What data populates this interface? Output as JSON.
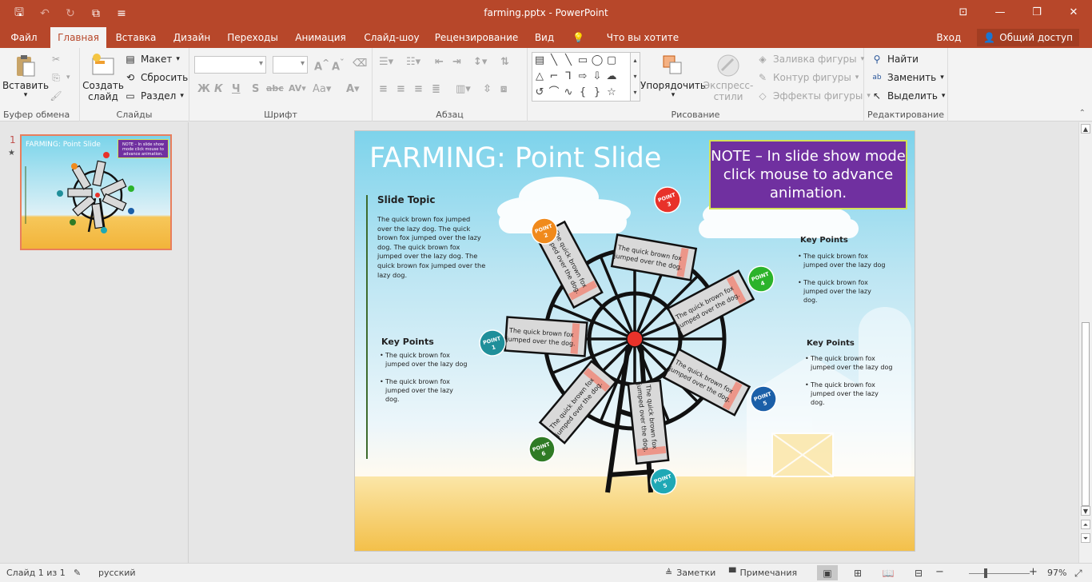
{
  "window": {
    "title": "farming.pptx - PowerPoint"
  },
  "tabs": [
    {
      "label": "Файл",
      "active": false
    },
    {
      "label": "Главная",
      "active": true
    },
    {
      "label": "Вставка",
      "active": false
    },
    {
      "label": "Дизайн",
      "active": false
    },
    {
      "label": "Переходы",
      "active": false
    },
    {
      "label": "Анимация",
      "active": false
    },
    {
      "label": "Слайд-шоу",
      "active": false
    },
    {
      "label": "Рецензирование",
      "active": false
    },
    {
      "label": "Вид",
      "active": false
    }
  ],
  "tellme": "Что вы хотите сделать?",
  "signin": "Вход",
  "share": "Общий доступ",
  "ribbon": {
    "clipboard": {
      "paste": "Вставить",
      "label": "Буфер обмена"
    },
    "slides": {
      "new_slide_1": "Создать",
      "new_slide_2": "слайд",
      "layout": "Макет",
      "reset": "Сбросить",
      "section": "Раздел",
      "label": "Слайды"
    },
    "font": {
      "label": "Шрифт",
      "bold": "Ж",
      "italic": "К",
      "underline": "Ч",
      "strike": "S",
      "aa": "Аа"
    },
    "paragraph": {
      "label": "Абзац"
    },
    "drawing": {
      "arrange": "Упорядочить",
      "styles_1": "Экспресс-",
      "styles_2": "стили",
      "fill": "Заливка фигуры",
      "outline": "Контур фигуры",
      "effects": "Эффекты фигуры",
      "label": "Рисование"
    },
    "editing": {
      "find": "Найти",
      "replace": "Заменить",
      "select": "Выделить",
      "label": "Редактирование"
    }
  },
  "thumb": {
    "number": "1",
    "star": "★",
    "title": "FARMING: Point Slide",
    "note": "NOTE – In slide show mode click mouse to advance animation."
  },
  "slide": {
    "title": "FARMING: Point Slide",
    "note": "NOTE – In slide show mode click mouse to advance animation.",
    "topic_heading": "Slide Topic",
    "topic_body": "The quick brown fox jumped over the lazy dog. The quick brown fox jumped over the lazy dog. The quick brown fox jumped over the lazy dog. The quick brown fox jumped over the lazy dog.",
    "left_kp": {
      "heading": "Key Points",
      "items": [
        "The quick brown fox jumped over the lazy dog",
        "The quick brown fox jumped over the lazy dog."
      ]
    },
    "right_kp1": {
      "heading": "Key Points",
      "items": [
        "The quick brown fox jumped over the lazy dog",
        "The quick brown fox jumped over the lazy dog."
      ]
    },
    "right_kp2": {
      "heading": "Key Points",
      "items": [
        "The quick brown fox jumped over the lazy dog",
        "The quick brown fox jumped over the lazy dog."
      ]
    },
    "blade_text": "The quick brown fox jumped over the dog.",
    "points": [
      {
        "word": "POINT",
        "num": "1",
        "color": "#1f8f9a"
      },
      {
        "word": "POINT",
        "num": "2",
        "color": "#f08a1c"
      },
      {
        "word": "POINT",
        "num": "3",
        "color": "#e8322a"
      },
      {
        "word": "POINT",
        "num": "4",
        "color": "#2bb32a"
      },
      {
        "word": "POINT",
        "num": "5",
        "color": "#1b5fa8"
      },
      {
        "word": "POINT",
        "num": "5",
        "color": "#1fa8b5"
      },
      {
        "word": "POINT",
        "num": "6",
        "color": "#2f7b25"
      }
    ]
  },
  "status": {
    "slide_of": "Слайд 1 из 1",
    "language": "русский",
    "notes": "Заметки",
    "comments": "Примечания",
    "zoom": "97%",
    "minus": "−",
    "plus": "+"
  },
  "colors": {
    "accent": "#b7472a",
    "note_bg": "#7030a0"
  }
}
